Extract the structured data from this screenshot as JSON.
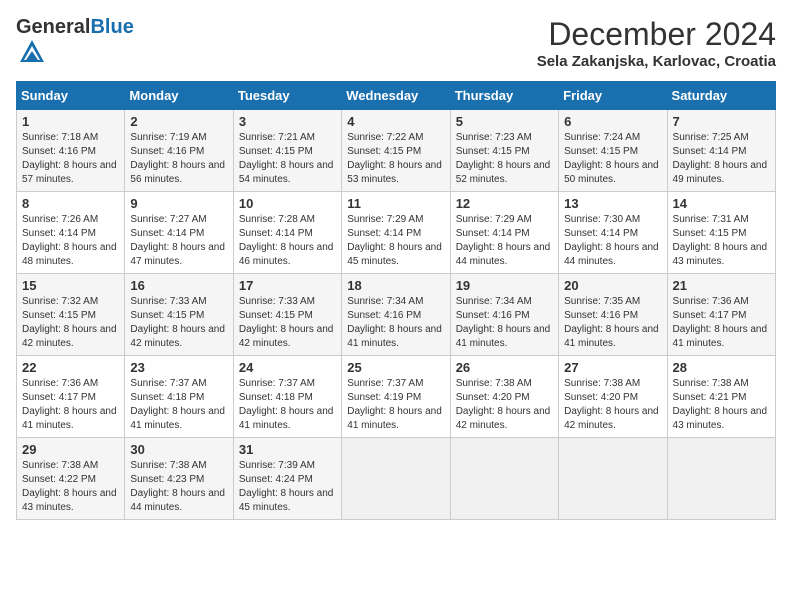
{
  "header": {
    "logo_general": "General",
    "logo_blue": "Blue",
    "month_title": "December 2024",
    "location": "Sela Zakanjska, Karlovac, Croatia"
  },
  "calendar": {
    "days_of_week": [
      "Sunday",
      "Monday",
      "Tuesday",
      "Wednesday",
      "Thursday",
      "Friday",
      "Saturday"
    ],
    "weeks": [
      [
        {
          "day": "1",
          "sunrise": "7:18 AM",
          "sunset": "4:16 PM",
          "daylight": "8 hours and 57 minutes."
        },
        {
          "day": "2",
          "sunrise": "7:19 AM",
          "sunset": "4:16 PM",
          "daylight": "8 hours and 56 minutes."
        },
        {
          "day": "3",
          "sunrise": "7:21 AM",
          "sunset": "4:15 PM",
          "daylight": "8 hours and 54 minutes."
        },
        {
          "day": "4",
          "sunrise": "7:22 AM",
          "sunset": "4:15 PM",
          "daylight": "8 hours and 53 minutes."
        },
        {
          "day": "5",
          "sunrise": "7:23 AM",
          "sunset": "4:15 PM",
          "daylight": "8 hours and 52 minutes."
        },
        {
          "day": "6",
          "sunrise": "7:24 AM",
          "sunset": "4:15 PM",
          "daylight": "8 hours and 50 minutes."
        },
        {
          "day": "7",
          "sunrise": "7:25 AM",
          "sunset": "4:14 PM",
          "daylight": "8 hours and 49 minutes."
        }
      ],
      [
        {
          "day": "8",
          "sunrise": "7:26 AM",
          "sunset": "4:14 PM",
          "daylight": "8 hours and 48 minutes."
        },
        {
          "day": "9",
          "sunrise": "7:27 AM",
          "sunset": "4:14 PM",
          "daylight": "8 hours and 47 minutes."
        },
        {
          "day": "10",
          "sunrise": "7:28 AM",
          "sunset": "4:14 PM",
          "daylight": "8 hours and 46 minutes."
        },
        {
          "day": "11",
          "sunrise": "7:29 AM",
          "sunset": "4:14 PM",
          "daylight": "8 hours and 45 minutes."
        },
        {
          "day": "12",
          "sunrise": "7:29 AM",
          "sunset": "4:14 PM",
          "daylight": "8 hours and 44 minutes."
        },
        {
          "day": "13",
          "sunrise": "7:30 AM",
          "sunset": "4:14 PM",
          "daylight": "8 hours and 44 minutes."
        },
        {
          "day": "14",
          "sunrise": "7:31 AM",
          "sunset": "4:15 PM",
          "daylight": "8 hours and 43 minutes."
        }
      ],
      [
        {
          "day": "15",
          "sunrise": "7:32 AM",
          "sunset": "4:15 PM",
          "daylight": "8 hours and 42 minutes."
        },
        {
          "day": "16",
          "sunrise": "7:33 AM",
          "sunset": "4:15 PM",
          "daylight": "8 hours and 42 minutes."
        },
        {
          "day": "17",
          "sunrise": "7:33 AM",
          "sunset": "4:15 PM",
          "daylight": "8 hours and 42 minutes."
        },
        {
          "day": "18",
          "sunrise": "7:34 AM",
          "sunset": "4:16 PM",
          "daylight": "8 hours and 41 minutes."
        },
        {
          "day": "19",
          "sunrise": "7:34 AM",
          "sunset": "4:16 PM",
          "daylight": "8 hours and 41 minutes."
        },
        {
          "day": "20",
          "sunrise": "7:35 AM",
          "sunset": "4:16 PM",
          "daylight": "8 hours and 41 minutes."
        },
        {
          "day": "21",
          "sunrise": "7:36 AM",
          "sunset": "4:17 PM",
          "daylight": "8 hours and 41 minutes."
        }
      ],
      [
        {
          "day": "22",
          "sunrise": "7:36 AM",
          "sunset": "4:17 PM",
          "daylight": "8 hours and 41 minutes."
        },
        {
          "day": "23",
          "sunrise": "7:37 AM",
          "sunset": "4:18 PM",
          "daylight": "8 hours and 41 minutes."
        },
        {
          "day": "24",
          "sunrise": "7:37 AM",
          "sunset": "4:18 PM",
          "daylight": "8 hours and 41 minutes."
        },
        {
          "day": "25",
          "sunrise": "7:37 AM",
          "sunset": "4:19 PM",
          "daylight": "8 hours and 41 minutes."
        },
        {
          "day": "26",
          "sunrise": "7:38 AM",
          "sunset": "4:20 PM",
          "daylight": "8 hours and 42 minutes."
        },
        {
          "day": "27",
          "sunrise": "7:38 AM",
          "sunset": "4:20 PM",
          "daylight": "8 hours and 42 minutes."
        },
        {
          "day": "28",
          "sunrise": "7:38 AM",
          "sunset": "4:21 PM",
          "daylight": "8 hours and 43 minutes."
        }
      ],
      [
        {
          "day": "29",
          "sunrise": "7:38 AM",
          "sunset": "4:22 PM",
          "daylight": "8 hours and 43 minutes."
        },
        {
          "day": "30",
          "sunrise": "7:38 AM",
          "sunset": "4:23 PM",
          "daylight": "8 hours and 44 minutes."
        },
        {
          "day": "31",
          "sunrise": "7:39 AM",
          "sunset": "4:24 PM",
          "daylight": "8 hours and 45 minutes."
        },
        null,
        null,
        null,
        null
      ]
    ]
  },
  "labels": {
    "sunrise": "Sunrise:",
    "sunset": "Sunset:",
    "daylight": "Daylight:"
  }
}
